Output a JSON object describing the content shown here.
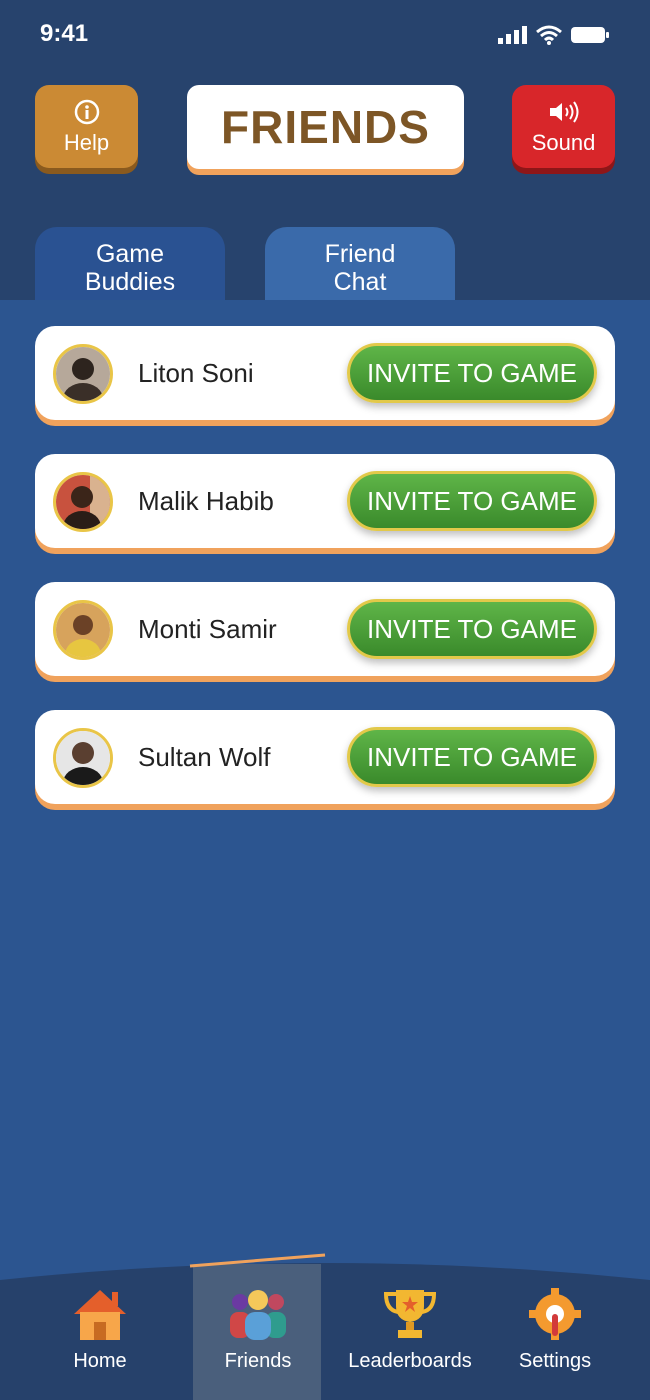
{
  "status": {
    "time": "9:41"
  },
  "header": {
    "title": "FRIENDS",
    "help_label": "Help",
    "sound_label": "Sound"
  },
  "tabs": [
    {
      "label_line1": "Game",
      "label_line2": "Buddies"
    },
    {
      "label_line1": "Friend",
      "label_line2": "Chat"
    }
  ],
  "friends": [
    {
      "name": "Liton Soni",
      "button": "INVITE TO GAME"
    },
    {
      "name": "Malik Habib",
      "button": "INVITE TO GAME"
    },
    {
      "name": "Monti Samir",
      "button": "INVITE TO GAME"
    },
    {
      "name": "Sultan Wolf",
      "button": "INVITE TO GAME"
    }
  ],
  "nav": {
    "home": "Home",
    "friends": "Friends",
    "leaderboards": "Leaderboards",
    "settings": "Settings"
  },
  "colors": {
    "background": "#2c5590",
    "header_bg": "#27436d",
    "help": "#cb8a34",
    "sound": "#d8262a",
    "accent_orange": "#f0a25c",
    "invite_green": "#4c9f38"
  }
}
